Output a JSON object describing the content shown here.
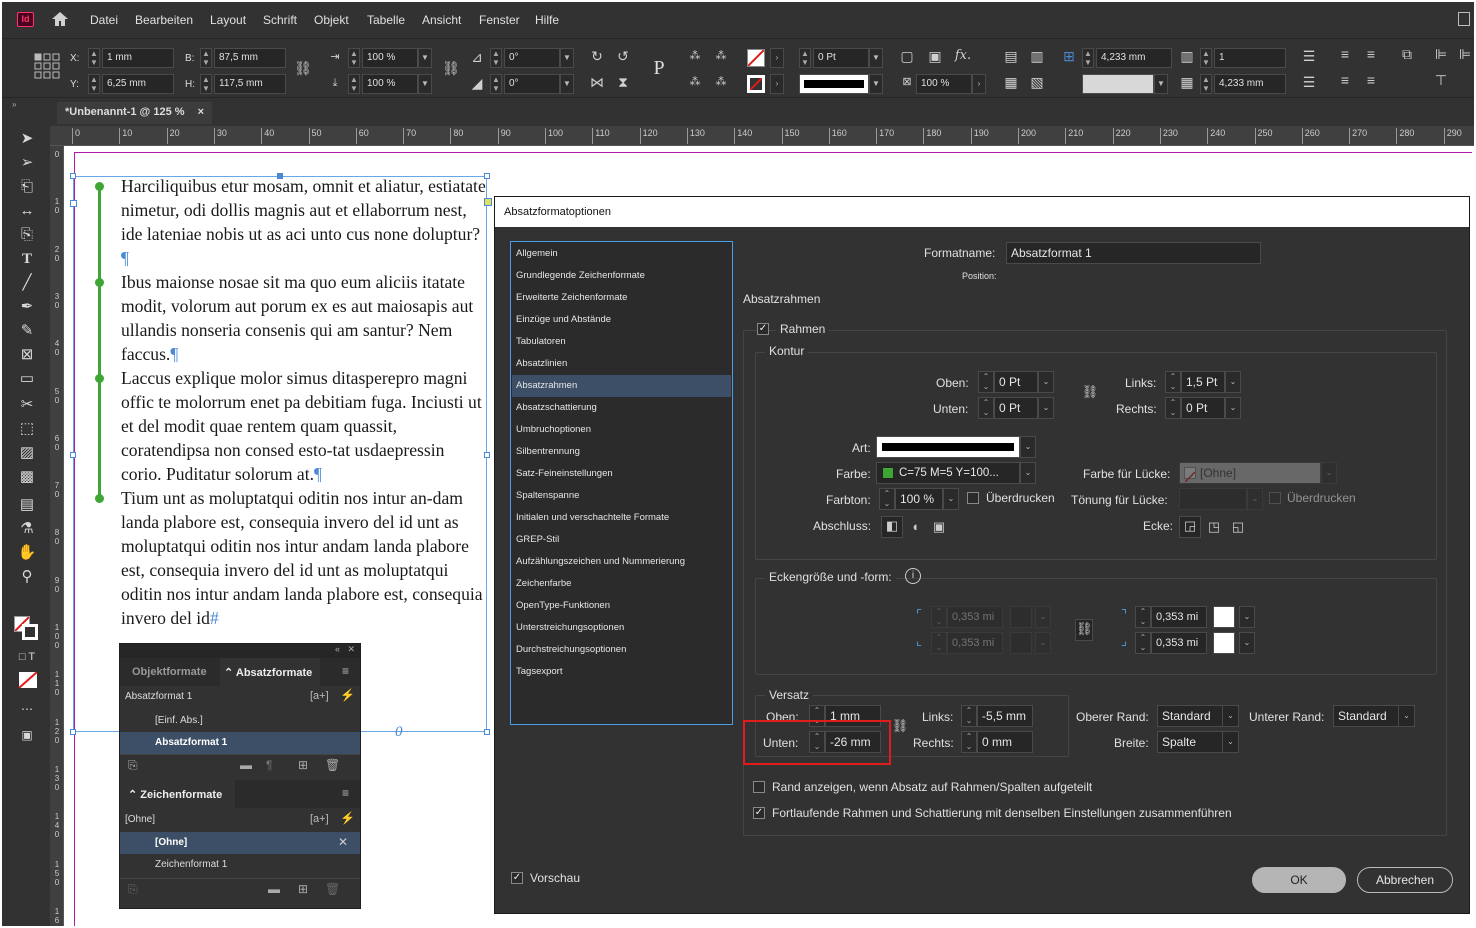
{
  "menubar": {
    "items": [
      "Datei",
      "Bearbeiten",
      "Layout",
      "Schrift",
      "Objekt",
      "Tabelle",
      "Ansicht",
      "Fenster",
      "Hilfe"
    ],
    "logo": "Id"
  },
  "control": {
    "x_label": "X:",
    "x_value": "1 mm",
    "y_label": "Y:",
    "y_value": "6,25 mm",
    "w_label": "B:",
    "w_value": "87,5 mm",
    "h_label": "H:",
    "h_value": "117,5 mm",
    "scale_x": "100 %",
    "scale_y": "100 %",
    "rotate": "0°",
    "shear": "0°",
    "stroke_weight": "0 Pt",
    "opacity": "100 %",
    "text_wrap_offset": "4,233 mm",
    "columns": "1",
    "gutter": "4,233 mm"
  },
  "document": {
    "tab_title": "*Unbenannt-1 @ 125 %",
    "close_icon": "×",
    "ruler_h": [
      "0",
      "10",
      "20",
      "30",
      "40",
      "50",
      "60",
      "70",
      "80",
      "90",
      "100",
      "110",
      "120",
      "130",
      "140",
      "150",
      "160",
      "170",
      "180",
      "190",
      "200",
      "210",
      "220",
      "230",
      "240",
      "250",
      "260",
      "270",
      "280",
      "290"
    ],
    "ruler_v": [
      "0",
      "10",
      "20",
      "30",
      "40",
      "50",
      "60",
      "70",
      "80",
      "90",
      "100",
      "110",
      "120",
      "130",
      "140",
      "150",
      "160"
    ],
    "paragraphs": [
      "Harciliquibus etur mosam, omnit et aliatur, estiatate nimetur, odi dollis magnis aut et ellaborrum nest, ide lateniae nobis ut as aci unto cus none doluptur?",
      "Ibus maionse nosae sit ma quo eum aliciis itatate modit, volorum aut porum ex es aut maiosapis aut ullandis nonseria consenis qui am santur? Nem faccus.",
      "Laccus explique molor simus ditasperepro magni offic te molorrum enet pa debitiam fuga. Inciusti ut et del modit quae rentem quam quassit, coratendipsa non consed esto-tat usdaepressin corio. Puditatur solorum at.",
      "Tium unt as moluptatqui oditin nos intur an-dam landa plabore est, consequia invero del id unt as moluptatqui oditin nos intur andam landa plabore est, consequia invero del id unt as moluptatqui oditin nos intur andam landa plabore est, consequia invero del id"
    ],
    "pilcrow": "¶",
    "end_mark": "#",
    "overset_mark": "0"
  },
  "panel": {
    "tab_objekt": "Objektformate",
    "tab_absatz": "Absatzformate",
    "absatz_current": "Absatzformat 1",
    "absatz_new_style": "[a+]",
    "absatz_items": [
      "[Einf. Abs.]",
      "Absatzformat 1"
    ],
    "zeichen_tab": "Zeichenformate",
    "zeichen_current": "[Ohne]",
    "zeichen_items": [
      "[Ohne]",
      "Zeichenformat 1"
    ]
  },
  "dialog": {
    "title": "Absatzformatoptionen",
    "categories": [
      "Allgemein",
      "Grundlegende Zeichenformate",
      "Erweiterte Zeichenformate",
      "Einzüge und Abstände",
      "Tabulatoren",
      "Absatzlinien",
      "Absatzrahmen",
      "Absatzschattierung",
      "Umbruchoptionen",
      "Silbentrennung",
      "Satz-Feineinstellungen",
      "Spaltenspanne",
      "Initialen und verschachtelte Formate",
      "GREP-Stil",
      "Aufzählungszeichen und Nummerierung",
      "Zeichenfarbe",
      "OpenType-Funktionen",
      "Unterstreichungsoptionen",
      "Durchstreichungsoptionen",
      "Tagsexport"
    ],
    "selected_category": "Absatzrahmen",
    "formatname_label": "Formatname:",
    "formatname_value": "Absatzformat 1",
    "position_label": "Position:",
    "section_title": "Absatzrahmen",
    "rahmen_label": "Rahmen",
    "kontur": {
      "title": "Kontur",
      "oben_label": "Oben:",
      "oben_value": "0 Pt",
      "unten_label": "Unten:",
      "unten_value": "0 Pt",
      "links_label": "Links:",
      "links_value": "1,5 Pt",
      "rechts_label": "Rechts:",
      "rechts_value": "0 Pt",
      "art_label": "Art:",
      "farbe_label": "Farbe:",
      "farbe_value": "C=75 M=5 Y=100...",
      "farbe_swatch": "#3fa535",
      "farbton_label": "Farbton:",
      "farbton_value": "100 %",
      "ueberdrucken_label": "Überdrucken",
      "abschluss_label": "Abschluss:",
      "luecke_label": "Farbe für Lücke:",
      "luecke_value": "[Ohne]",
      "toenung_label": "Tönung für Lücke:",
      "ueberdrucken2_label": "Überdrucken",
      "ecke_label": "Ecke:"
    },
    "ecken": {
      "title": "Eckengröße und -form:",
      "info_icon": "i",
      "tl_value": "0,353 mi",
      "bl_value": "0,353 mi",
      "tr_value": "0,353 mi",
      "br_value": "0,353 mi"
    },
    "versatz": {
      "title": "Versatz",
      "oben_label": "Oben:",
      "oben_value": "1 mm",
      "unten_label": "Unten:",
      "unten_value": "-26 mm",
      "links_label": "Links:",
      "links_value": "-5,5 mm",
      "rechts_label": "Rechts:",
      "rechts_value": "0 mm",
      "oberer_rand_label": "Oberer Rand:",
      "oberer_rand_value": "Standard",
      "unterer_rand_label": "Unterer Rand:",
      "unterer_rand_value": "Standard",
      "breite_label": "Breite:",
      "breite_value": "Spalte"
    },
    "rand_anzeigen_label": "Rand anzeigen, wenn Absatz auf Rahmen/Spalten aufgeteilt",
    "fortlaufend_label": "Fortlaufende Rahmen und Schattierung mit denselben Einstellungen zusammenführen",
    "vorschau_label": "Vorschau",
    "ok_label": "OK",
    "cancel_label": "Abbrechen"
  },
  "colors": {
    "accent_green": "#3fa535",
    "selection_blue": "#4a8ad4",
    "highlight_red": "#e21b1b"
  }
}
